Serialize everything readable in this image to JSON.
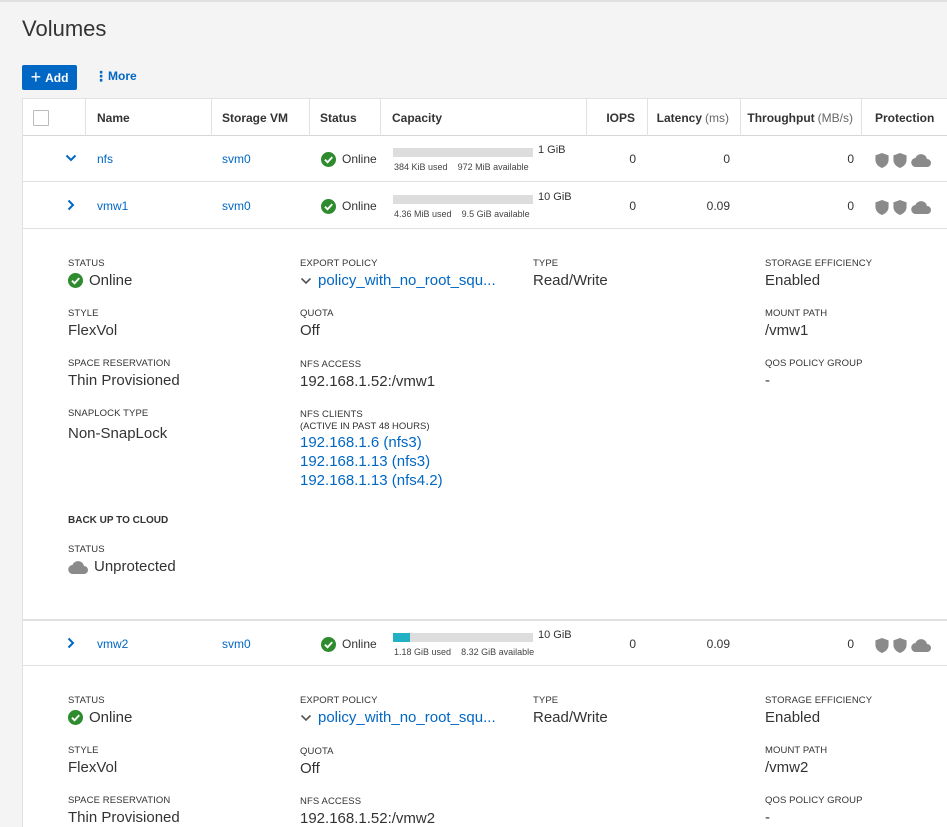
{
  "page": {
    "title": "Volumes"
  },
  "toolbar": {
    "add_label": "Add",
    "more_label": "More"
  },
  "columns": {
    "name": "Name",
    "storage_vm": "Storage VM",
    "status": "Status",
    "capacity": "Capacity",
    "iops": "IOPS",
    "latency": "Latency",
    "latency_unit": "(ms)",
    "throughput": "Throughput",
    "throughput_unit": "(MB/s)",
    "protection": "Protection"
  },
  "colors": {
    "accent": "#0067c5",
    "online": "#2e8b2e",
    "capacity_fill": "#22b1c4",
    "shield": "#8a8a8a"
  },
  "volumes": [
    {
      "name": "nfs",
      "svm": "svm0",
      "status": "Online",
      "capacity_total": "1 GiB",
      "used": "384 KiB used",
      "available": "972 MiB available",
      "used_fraction": 0.0004,
      "iops": "0",
      "latency": "0",
      "throughput": "0",
      "expanded": true
    },
    {
      "name": "vmw1",
      "svm": "svm0",
      "status": "Online",
      "capacity_total": "10 GiB",
      "used": "4.36 MiB used",
      "available": "9.5 GiB available",
      "used_fraction": 0.0004,
      "iops": "0",
      "latency": "0.09",
      "throughput": "0",
      "expanded": true
    },
    {
      "name": "vmw2",
      "svm": "svm0",
      "status": "Online",
      "capacity_total": "10 GiB",
      "used": "1.18 GiB used",
      "available": "8.32 GiB available",
      "used_fraction": 0.118,
      "iops": "0",
      "latency": "0.09",
      "throughput": "0",
      "expanded": true
    }
  ],
  "details": [
    {
      "status_label": "STATUS",
      "status": "Online",
      "export_policy_label": "EXPORT POLICY",
      "export_policy": "policy_with_no_root_squ...",
      "type_label": "TYPE",
      "type": "Read/Write",
      "storage_efficiency_label": "STORAGE EFFICIENCY",
      "storage_efficiency": "Enabled",
      "style_label": "STYLE",
      "style": "FlexVol",
      "quota_label": "QUOTA",
      "quota": "Off",
      "mount_path_label": "MOUNT PATH",
      "mount_path": "/vmw1",
      "space_reservation_label": "SPACE RESERVATION",
      "space_reservation": "Thin Provisioned",
      "nfs_access_label": "NFS ACCESS",
      "nfs_access": "192.168.1.52:/vmw1",
      "qos_label": "QOS POLICY GROUP",
      "qos": "-",
      "snaplock_label": "SNAPLOCK TYPE",
      "snaplock": "Non-SnapLock",
      "nfs_clients_label": "NFS CLIENTS",
      "nfs_clients_sub": "(ACTIVE IN PAST 48 HOURS)",
      "nfs_clients": [
        "192.168.1.6 (nfs3)",
        "192.168.1.13 (nfs3)",
        "192.168.1.13 (nfs4.2)"
      ],
      "backup_title": "BACK UP TO CLOUD",
      "backup_status_label": "STATUS",
      "backup_status": "Unprotected"
    },
    {
      "status_label": "STATUS",
      "status": "Online",
      "export_policy_label": "EXPORT POLICY",
      "export_policy": "policy_with_no_root_squ...",
      "type_label": "TYPE",
      "type": "Read/Write",
      "storage_efficiency_label": "STORAGE EFFICIENCY",
      "storage_efficiency": "Enabled",
      "style_label": "STYLE",
      "style": "FlexVol",
      "quota_label": "QUOTA",
      "quota": "Off",
      "mount_path_label": "MOUNT PATH",
      "mount_path": "/vmw2",
      "space_reservation_label": "SPACE RESERVATION",
      "space_reservation": "Thin Provisioned",
      "nfs_access_label": "NFS ACCESS",
      "nfs_access": "192.168.1.52:/vmw2",
      "qos_label": "QOS POLICY GROUP",
      "qos": "-"
    }
  ]
}
